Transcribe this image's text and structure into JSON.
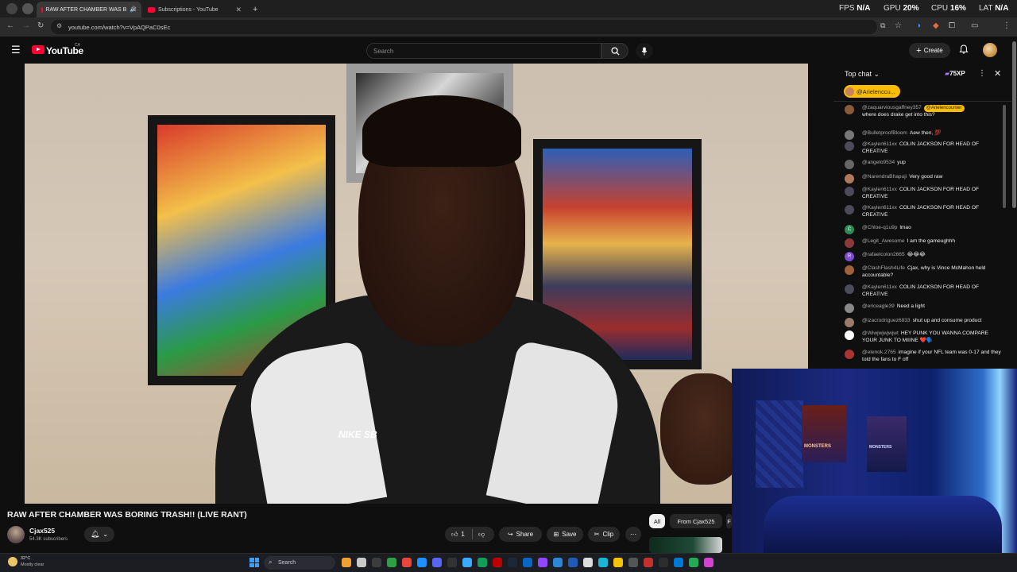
{
  "browser": {
    "tabs": [
      {
        "title": "RAW AFTER CHAMBER WAS B",
        "active": true
      },
      {
        "title": "Subscriptions - YouTube",
        "active": false
      }
    ],
    "url": "youtube.com/watch?v=VpAQPaC0sEc",
    "osd": {
      "fps_label": "FPS",
      "fps": "N/A",
      "gpu_label": "GPU",
      "gpu": "20%",
      "cpu_label": "CPU",
      "cpu": "16%",
      "lat_label": "LAT",
      "lat": "N/A"
    }
  },
  "youtube": {
    "logo": "YouTube",
    "region": "CA",
    "search_placeholder": "Search",
    "create_label": "Create"
  },
  "chat": {
    "title": "Top chat",
    "xp": "75XP",
    "pinned": "@Arielenccu...",
    "messages": [
      {
        "user": "@zaquarviousgaffney357",
        "text": "where does drake get into this?",
        "mention": "@Arielencounter",
        "color": "#8a5a3a"
      },
      {
        "user": "@BulletproofBloom",
        "text": "Aew then, 💯",
        "color": "#777"
      },
      {
        "user": "@Kaylen611xx",
        "text": "COLIN JACKSON FOR HEAD OF CREATIVE",
        "color": "#4b4b5a"
      },
      {
        "user": "@angelo9534",
        "text": "yup",
        "color": "#666"
      },
      {
        "user": "@NarendraBhapuji",
        "text": "Very good raw",
        "color": "#b07a5a"
      },
      {
        "user": "@Kaylen611xx",
        "text": "COLIN JACKSON FOR HEAD OF CREATIVE",
        "color": "#4b4b5a"
      },
      {
        "user": "@Kaylen611xx",
        "text": "COLIN JACKSON FOR HEAD OF CREATIVE",
        "color": "#4b4b5a"
      },
      {
        "user": "@Chloe-q1u9p",
        "text": "lmao",
        "color": "#2e8b57",
        "initial": "C"
      },
      {
        "user": "@Legit_Awesome",
        "text": "I am the gameughhh",
        "color": "#8b3a3a"
      },
      {
        "user": "@rafaelcolon2665",
        "text": "😂😂😂",
        "color": "#7b4bd0",
        "initial": "R"
      },
      {
        "user": "@ClashFlash4Life",
        "text": "Cjax, why is Vince McMahon held accountable?",
        "color": "#a0603a"
      },
      {
        "user": "@Kaylen611xx",
        "text": "COLIN JACKSON FOR HEAD OF CREATIVE",
        "color": "#4b4b5a"
      },
      {
        "user": "@ericeagle39",
        "text": "Need a light",
        "color": "#888"
      },
      {
        "user": "@izacrodriguez6833",
        "text": "shut up and consume product",
        "color": "#9a7a6a"
      },
      {
        "user": "@Wiwjwjwjwjwt",
        "text": "HEY PUNK YOU WANNA COMPARE YOUR JUNK TO MIIINE ❤️🗣️",
        "color": "#ffffff"
      },
      {
        "user": "@elenok.2765",
        "text": "imagine if your NFL team was 0-17 and they told the fans to F off",
        "color": "#a33"
      }
    ]
  },
  "webcam": {
    "poster1": "MONSTERS",
    "poster2": "MONSTERS"
  },
  "video": {
    "title": "RAW AFTER CHAMBER WAS BORING TRASH!! (LIVE RANT)",
    "channel": "Cjax525",
    "subscribers": "54.3K subscribers",
    "likes": "1",
    "share": "Share",
    "save": "Save",
    "clip": "Clip",
    "chips": [
      "All",
      "From Cjax525",
      "F"
    ],
    "jacket_logo": "NIKE SB"
  },
  "taskbar": {
    "temp": "32°C",
    "weather": "Mostly clear",
    "search": "Search"
  }
}
